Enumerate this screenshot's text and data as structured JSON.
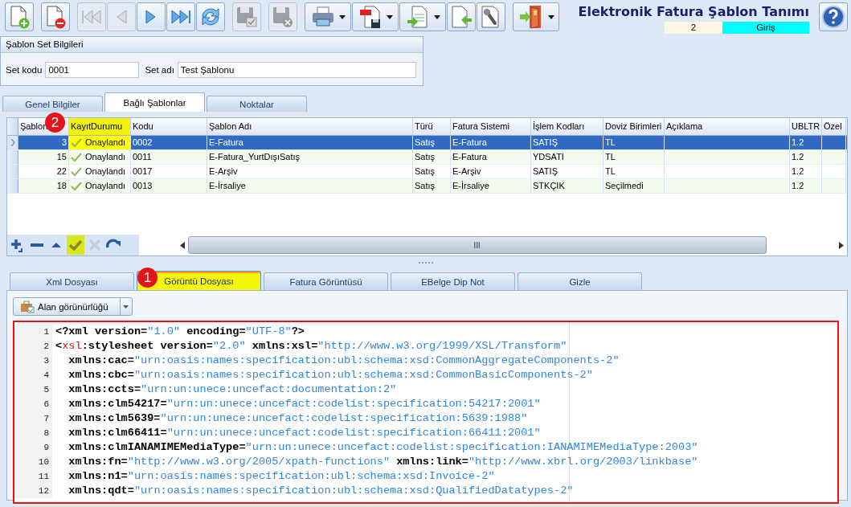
{
  "toolbar": [
    [
      {
        "kind": "new",
        "disabled": false,
        "dropdown": false
      }
    ],
    [
      {
        "kind": "delete",
        "disabled": false,
        "dropdown": false
      }
    ],
    [
      {
        "kind": "first",
        "disabled": true,
        "dropdown": false
      },
      {
        "kind": "previous",
        "disabled": true,
        "dropdown": false
      },
      {
        "kind": "next",
        "disabled": false,
        "dropdown": false
      },
      {
        "kind": "last",
        "disabled": false,
        "dropdown": false
      },
      {
        "kind": "refresh",
        "disabled": false,
        "dropdown": false
      }
    ],
    [
      {
        "kind": "save",
        "disabled": true,
        "dropdown": false
      }
    ],
    [
      {
        "kind": "discard",
        "disabled": true,
        "dropdown": false
      }
    ],
    [
      {
        "kind": "print",
        "disabled": false,
        "dropdown": true
      },
      {
        "kind": "pdf",
        "disabled": false,
        "dropdown": true
      },
      {
        "kind": "export",
        "disabled": false,
        "dropdown": true
      },
      {
        "kind": "import",
        "disabled": false,
        "dropdown": false
      },
      {
        "kind": "tools",
        "disabled": false,
        "dropdown": false
      }
    ],
    [
      {
        "kind": "exit",
        "disabled": false,
        "dropdown": true
      }
    ]
  ],
  "title": "Elektronik Fatura Şablon Tanımı",
  "record_number": "2",
  "mode": "Giriş",
  "set_panel": {
    "title": "Şablon Set Bilgileri",
    "fields": [
      {
        "label": "Set kodu",
        "value": "0001"
      },
      {
        "label": "Set adı",
        "value": "Test Şablonu"
      }
    ]
  },
  "tabs": [
    {
      "label": "Genel Bilgiler",
      "selected": false
    },
    {
      "label": "Bağlı Şablonlar",
      "selected": true
    },
    {
      "label": "Noktalar",
      "selected": false
    }
  ],
  "grid": {
    "columns": [
      {
        "label": "Şablon",
        "highlighted": false
      },
      {
        "label": "KayıtDurumu",
        "highlighted": true,
        "marker": "2"
      },
      {
        "label": "Kodu",
        "highlighted": false
      },
      {
        "label": "Şablon Adı",
        "highlighted": false
      },
      {
        "label": "Türü",
        "highlighted": false
      },
      {
        "label": "Fatura Sistemi",
        "highlighted": false
      },
      {
        "label": "İşlem Kodları",
        "highlighted": false
      },
      {
        "label": "Doviz Birimleri",
        "highlighted": false
      },
      {
        "label": "Açıklama",
        "highlighted": false
      },
      {
        "label": "UBLTR",
        "highlighted": false
      },
      {
        "label": "Özel",
        "highlighted": false
      }
    ],
    "rows": [
      {
        "selected": true,
        "status_highlighted": true,
        "cells": [
          "3",
          "Onaylandı",
          "0002",
          "E-Fatura",
          "Satış",
          "E-Fatura",
          "SATIŞ",
          "TL",
          "",
          "1.2",
          ""
        ]
      },
      {
        "selected": false,
        "status_highlighted": false,
        "cells": [
          "15",
          "Onaylandı",
          "0011",
          "E-Fatura_YurtDışıSatış",
          "Satış",
          "E-Fatura",
          "YDSATI",
          "TL",
          "",
          "1.2",
          ""
        ]
      },
      {
        "selected": false,
        "status_highlighted": false,
        "cells": [
          "22",
          "Onaylandı",
          "0017",
          "E-Arşiv",
          "Satış",
          "E-Arşiv",
          "SATIŞ",
          "TL",
          "",
          "1.2",
          ""
        ]
      },
      {
        "selected": false,
        "status_highlighted": false,
        "cells": [
          "18",
          "Onaylandı",
          "0013",
          "E-İrsaliye",
          "Satış",
          "E-İrsaliye",
          "STKÇIK",
          "Seçilmedi",
          "",
          "1.2",
          ""
        ]
      }
    ],
    "navigator": [
      {
        "kind": "add",
        "disabled": false,
        "highlighted": false
      },
      {
        "kind": "remove",
        "disabled": false,
        "highlighted": false
      },
      {
        "kind": "up",
        "disabled": false,
        "highlighted": false
      },
      {
        "kind": "confirm",
        "disabled": false,
        "highlighted": true
      },
      {
        "kind": "cancel",
        "disabled": true,
        "highlighted": false
      },
      {
        "kind": "redo",
        "disabled": false,
        "highlighted": false
      }
    ]
  },
  "file_tabs": [
    {
      "label": "Xml Dosyası",
      "selected": false,
      "highlighted": false
    },
    {
      "label": "Görüntü Dosyası",
      "selected": true,
      "highlighted": true,
      "marker": "1"
    },
    {
      "label": "Fatura Görüntüsü",
      "selected": false,
      "highlighted": false
    },
    {
      "label": "EBelge Dip Not",
      "selected": false,
      "highlighted": false
    },
    {
      "label": "Gizle",
      "selected": false,
      "highlighted": false
    }
  ],
  "visibility_button": "Alan görünürlüğü",
  "code": {
    "highlighted": true,
    "lines": [
      {
        "number": "1",
        "segments": [
          {
            "kind": "plain",
            "text": "<?xml version="
          },
          {
            "kind": "value",
            "text": "\"1.0\""
          },
          {
            "kind": "plain",
            "text": " encoding="
          },
          {
            "kind": "value",
            "text": "\"UTF-8\""
          },
          {
            "kind": "plain",
            "text": "?>"
          }
        ]
      },
      {
        "number": "2",
        "segments": [
          {
            "kind": "plain",
            "text": "<"
          },
          {
            "kind": "tag",
            "text": "xsl"
          },
          {
            "kind": "plain",
            "text": ":stylesheet version="
          },
          {
            "kind": "value",
            "text": "\"2.0\""
          },
          {
            "kind": "plain",
            "text": " xmlns:xsl="
          },
          {
            "kind": "value",
            "text": "\"http://www.w3.org/1999/XSL/Transform\""
          }
        ]
      },
      {
        "number": "3",
        "segments": [
          {
            "kind": "plain",
            "text": "  xmlns:cac="
          },
          {
            "kind": "value",
            "text": "\"urn:oasis:names:specification:ubl:schema:xsd:CommonAggregateComponents-2\""
          }
        ]
      },
      {
        "number": "4",
        "segments": [
          {
            "kind": "plain",
            "text": "  xmlns:cbc="
          },
          {
            "kind": "value",
            "text": "\"urn:oasis:names:specification:ubl:schema:xsd:CommonBasicComponents-2\""
          }
        ]
      },
      {
        "number": "5",
        "segments": [
          {
            "kind": "plain",
            "text": "  xmlns:ccts="
          },
          {
            "kind": "value",
            "text": "\"urn:un:unece:uncefact:documentation:2\""
          }
        ]
      },
      {
        "number": "6",
        "segments": [
          {
            "kind": "plain",
            "text": "  xmlns:clm54217="
          },
          {
            "kind": "value",
            "text": "\"urn:un:unece:uncefact:codelist:specification:54217:2001\""
          }
        ]
      },
      {
        "number": "7",
        "segments": [
          {
            "kind": "plain",
            "text": "  xmlns:clm5639="
          },
          {
            "kind": "value",
            "text": "\"urn:un:unece:uncefact:codelist:specification:5639:1988\""
          }
        ]
      },
      {
        "number": "8",
        "segments": [
          {
            "kind": "plain",
            "text": "  xmlns:clm66411="
          },
          {
            "kind": "value",
            "text": "\"urn:un:unece:uncefact:codelist:specification:66411:2001\""
          }
        ]
      },
      {
        "number": "9",
        "segments": [
          {
            "kind": "plain",
            "text": "  xmlns:clmIANAMIMEMediaType="
          },
          {
            "kind": "value",
            "text": "\"urn:un:unece:uncefact:codelist:specification:IANAMIMEMediaType:2003\""
          }
        ]
      },
      {
        "number": "10",
        "segments": [
          {
            "kind": "plain",
            "text": "  xmlns:fn="
          },
          {
            "kind": "value",
            "text": "\"http://www.w3.org/2005/xpath-functions\""
          },
          {
            "kind": "plain",
            "text": " xmlns:link="
          },
          {
            "kind": "value",
            "text": "\"http://www.xbrl.org/2003/linkbase\""
          }
        ]
      },
      {
        "number": "11",
        "segments": [
          {
            "kind": "plain",
            "text": "  xmlns:n1="
          },
          {
            "kind": "value",
            "text": "\"urn:oasis:names:specification:ubl:schema:xsd:Invoice-2\""
          }
        ]
      },
      {
        "number": "12",
        "segments": [
          {
            "kind": "plain",
            "text": "  xmlns:qdt="
          },
          {
            "kind": "value",
            "text": "\"urn:oasis:names:specification:ubl:schema:xsd:QualifiedDatatypes-2\""
          }
        ]
      }
    ]
  }
}
